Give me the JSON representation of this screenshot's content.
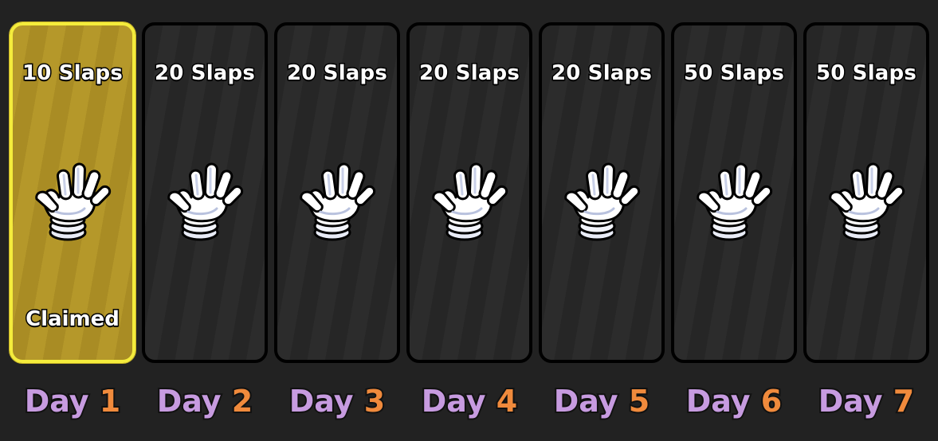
{
  "days": [
    {
      "reward": "10 Slaps",
      "status": "Claimed",
      "day_word": "Day",
      "day_num": "1",
      "icon": "glove-icon"
    },
    {
      "reward": "20 Slaps",
      "status": "",
      "day_word": "Day",
      "day_num": "2",
      "icon": "glove-icon"
    },
    {
      "reward": "20 Slaps",
      "status": "",
      "day_word": "Day",
      "day_num": "3",
      "icon": "glove-icon"
    },
    {
      "reward": "20 Slaps",
      "status": "",
      "day_word": "Day",
      "day_num": "4",
      "icon": "glove-icon"
    },
    {
      "reward": "20 Slaps",
      "status": "",
      "day_word": "Day",
      "day_num": "5",
      "icon": "glove-icon"
    },
    {
      "reward": "50 Slaps",
      "status": "",
      "day_word": "Day",
      "day_num": "6",
      "icon": "glove-icon"
    },
    {
      "reward": "50 Slaps",
      "status": "",
      "day_word": "Day",
      "day_num": "7",
      "icon": "glove-icon"
    }
  ],
  "colors": {
    "background": "#222222",
    "claimed_card": "#b5982a",
    "claimed_border": "#f4ec3c",
    "card": "#262626",
    "day_word": "#c79be0",
    "day_number": "#f08a3c"
  }
}
